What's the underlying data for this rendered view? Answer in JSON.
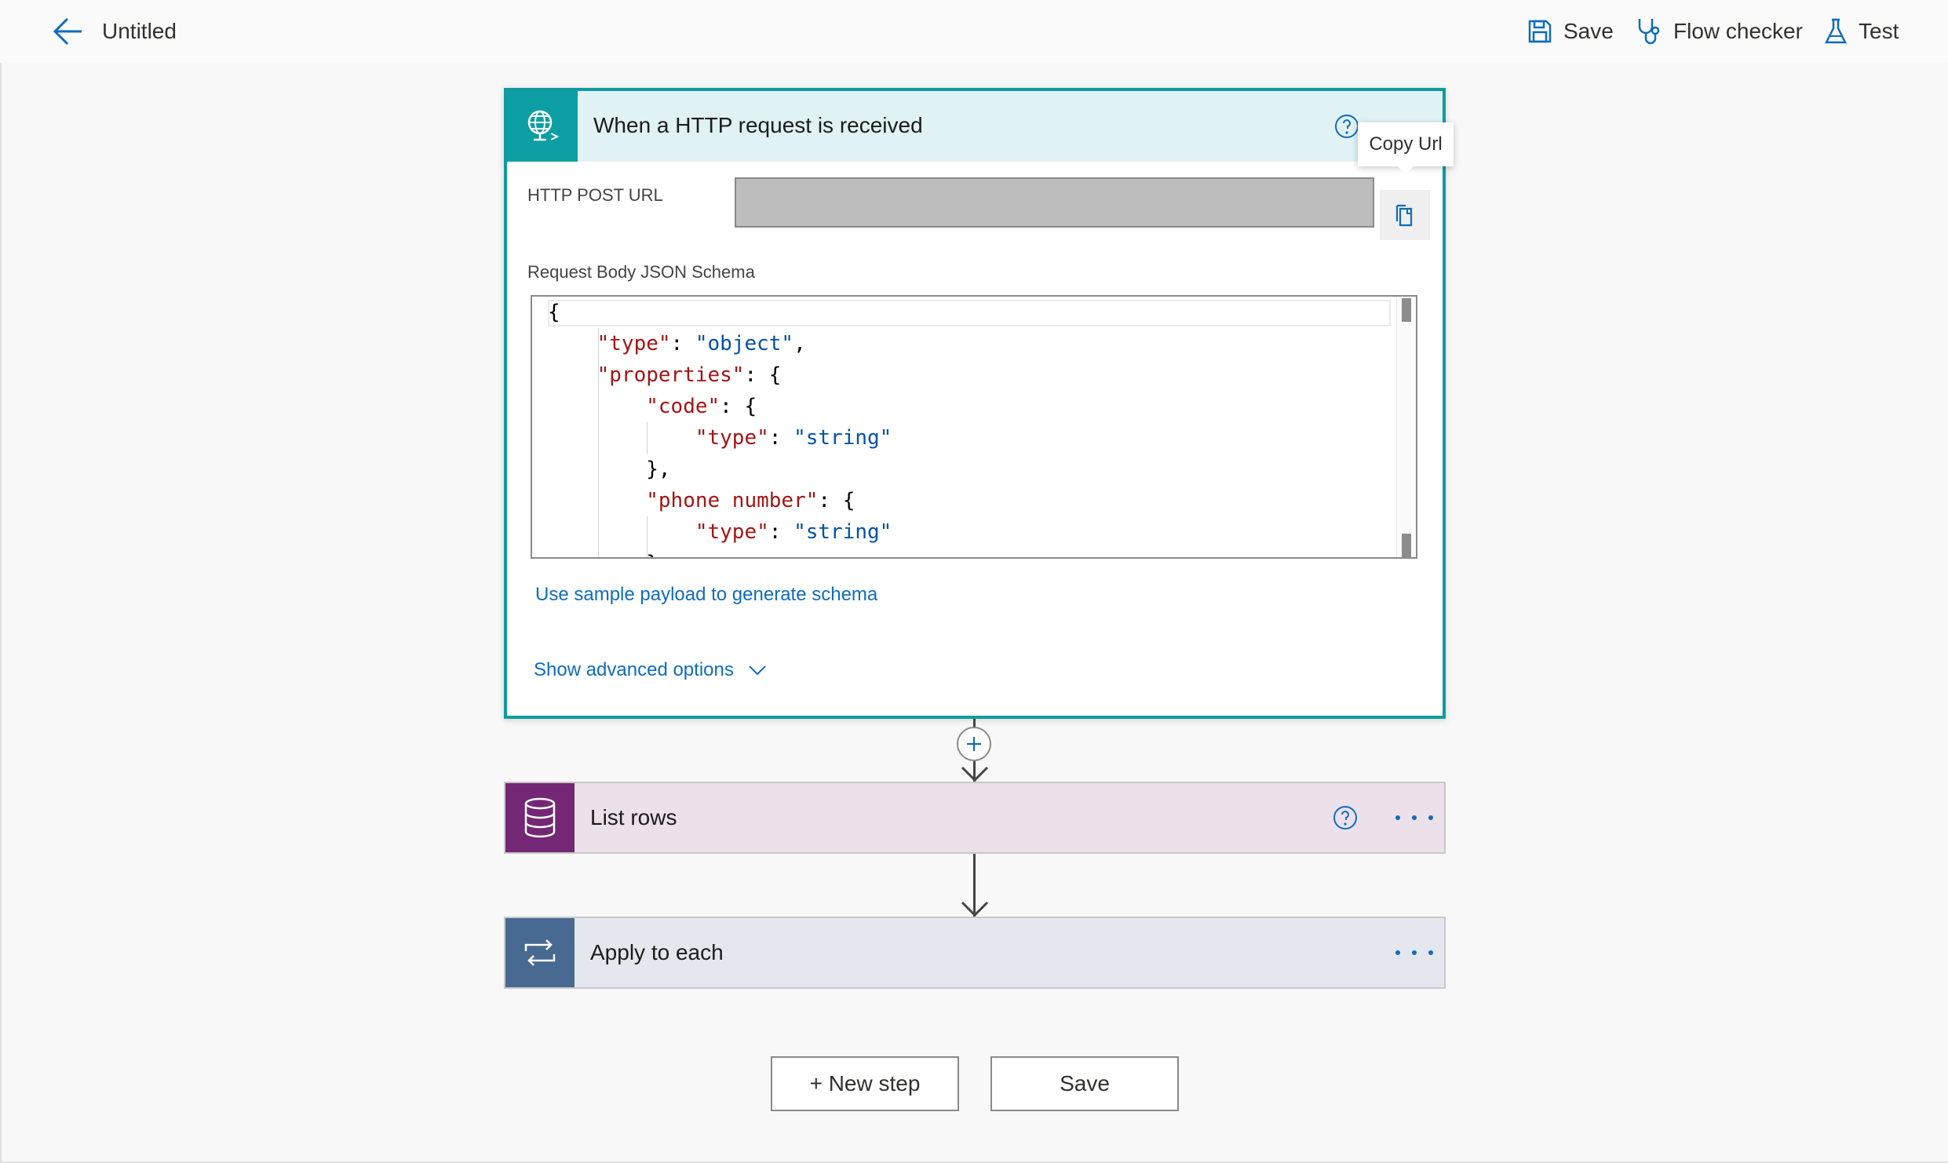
{
  "header": {
    "title": "Untitled",
    "save_label": "Save",
    "flow_checker_label": "Flow checker",
    "test_label": "Test"
  },
  "trigger": {
    "title": "When a HTTP request is received",
    "url_label": "HTTP POST URL",
    "copy_tooltip": "Copy Url",
    "schema_label": "Request Body JSON Schema",
    "schema_lines": [
      "{",
      "    \"type\": \"object\",",
      "    \"properties\": {",
      "        \"code\": {",
      "            \"type\": \"string\"",
      "        },",
      "        \"phone number\": {",
      "            \"type\": \"string\"",
      "        }"
    ],
    "sample_payload_link": "Use sample payload to generate schema",
    "advanced_options_link": "Show advanced options"
  },
  "actions": [
    {
      "title": "List rows",
      "color": "#742774",
      "head_bg": "#ece0ea"
    },
    {
      "title": "Apply to each",
      "color": "#486991",
      "head_bg": "#e4e8ee"
    }
  ],
  "footer": {
    "new_step_label": "+ New step",
    "save_label": "Save"
  },
  "colors": {
    "accent": "#0f9ba0",
    "link": "#0f6cbd"
  }
}
